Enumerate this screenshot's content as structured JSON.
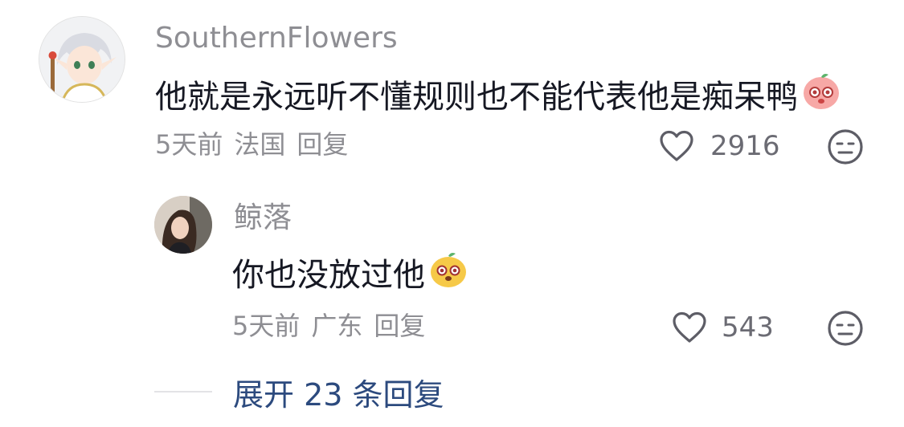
{
  "comment": {
    "username": "SouthernFlowers",
    "text": "他就是永远听不懂规则也不能代表他是痴呆鸭",
    "time": "5天前",
    "location": "法国",
    "reply_label": "回复",
    "likes": "2916",
    "emoji_icon": "pink-face-emoji-icon"
  },
  "reply": {
    "username": "鲸落",
    "text": "你也没放过他",
    "time": "5天前",
    "location": "广东",
    "reply_label": "回复",
    "likes": "543",
    "emoji_icon": "yellow-face-emoji-icon"
  },
  "expand": {
    "label": "展开 23 条回复"
  },
  "colors": {
    "username": "#8e8e93",
    "text": "#161823",
    "link": "#2c4a7e"
  }
}
